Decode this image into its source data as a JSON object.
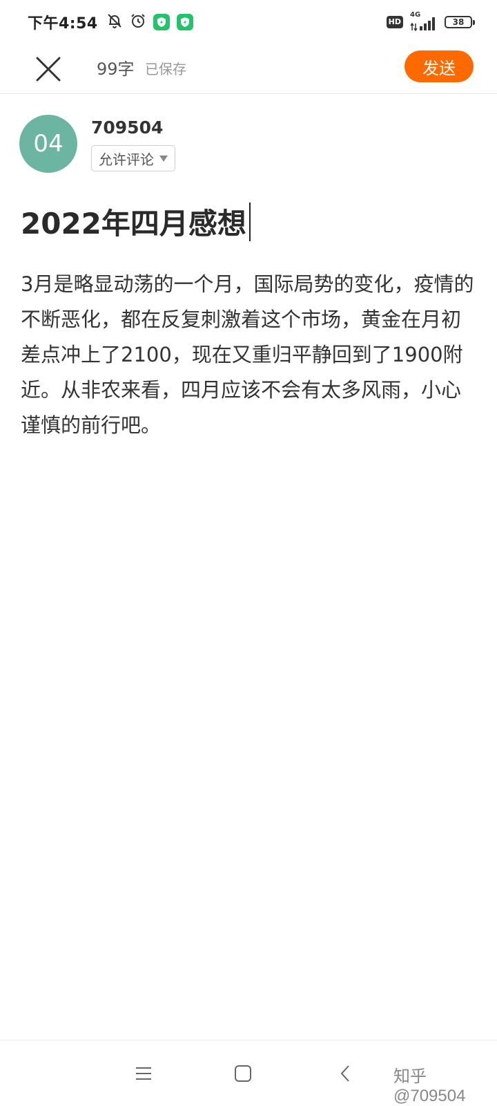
{
  "status_bar": {
    "time": "下午4:54",
    "left_icons": [
      "bell-off-icon",
      "alarm-icon",
      "shield-icon",
      "shield-icon"
    ],
    "hd_label": "HD",
    "network_label": "4G",
    "battery_level": "38"
  },
  "top_bar": {
    "word_count": "99字",
    "save_status": "已保存",
    "send_label": "发送"
  },
  "author": {
    "avatar_text": "04",
    "name": "709504",
    "comment_setting": "允许评论"
  },
  "article": {
    "title": "2022年四月感想",
    "body": "3月是略显动荡的一个月，国际局势的变化，疫情的不断恶化，都在反复刺激着这个市场，黄金在月初差点冲上了2100，现在又重归平静回到了1900附近。从非农来看，四月应该不会有太多风雨，小心谨慎的前行吧。"
  },
  "watermark": "知乎 @709504",
  "colors": {
    "accent": "#ff6a00",
    "avatar": "#6cb5a3",
    "shield_badge": "#23c26b"
  }
}
